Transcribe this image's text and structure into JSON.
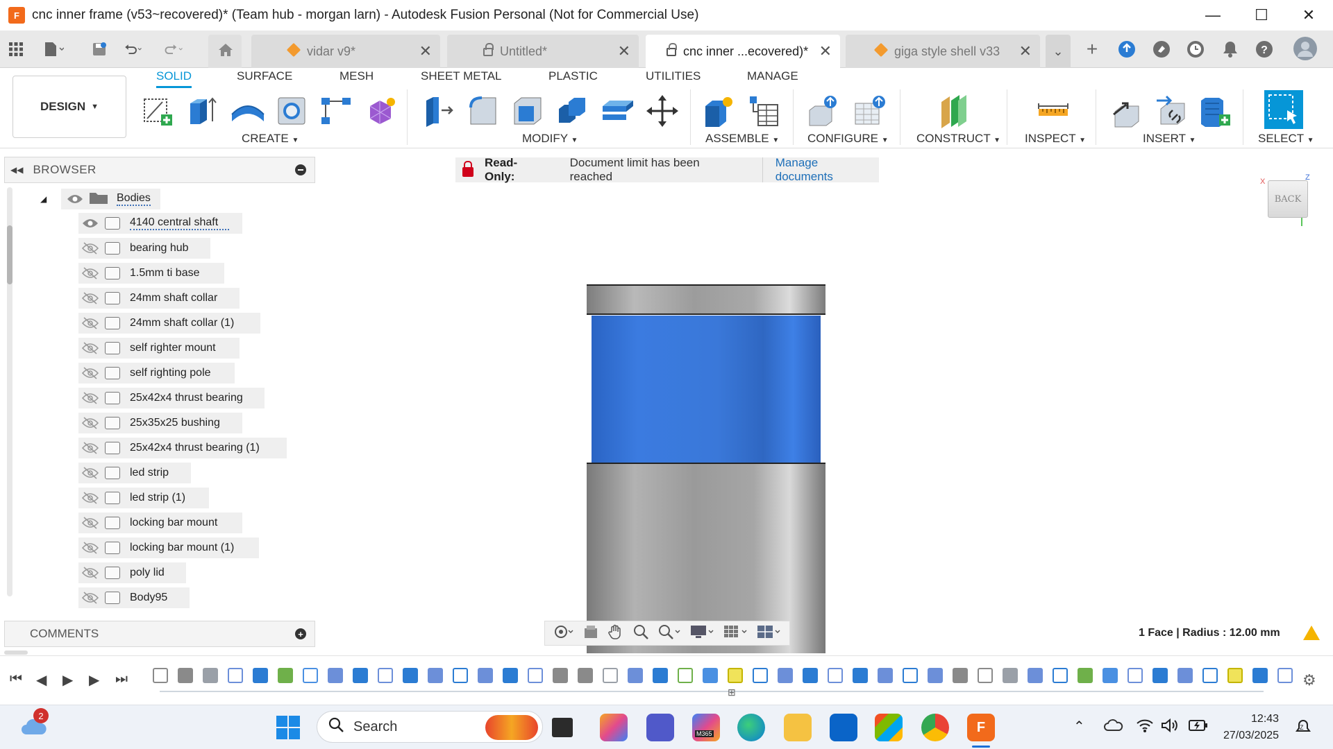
{
  "window": {
    "title": "cnc inner frame (v53~recovered)* (Team hub - morgan larn) - Autodesk Fusion Personal (Not for Commercial Use)",
    "logo_text": "F",
    "controls": {
      "minimize": "—",
      "maximize": "☐",
      "close": "✕"
    }
  },
  "tabs": [
    {
      "label": "vidar v9*",
      "icon": "component-cube-icon",
      "active": false
    },
    {
      "label": "Untitled*",
      "icon": "lock-icon",
      "active": false
    },
    {
      "label": "cnc inner ...ecovered)*",
      "icon": "lock-icon",
      "active": true
    },
    {
      "label": "giga style shell v33",
      "icon": "component-cube-icon",
      "active": false
    }
  ],
  "toolbar": {
    "workspace": "DESIGN",
    "mode_tabs": [
      "SOLID",
      "SURFACE",
      "MESH",
      "SHEET METAL",
      "PLASTIC",
      "UTILITIES",
      "MANAGE"
    ],
    "active_mode": "SOLID",
    "groups": [
      "CREATE",
      "MODIFY",
      "ASSEMBLE",
      "CONFIGURE",
      "CONSTRUCT",
      "INSPECT",
      "INSERT",
      "SELECT"
    ]
  },
  "browser": {
    "title": "BROWSER",
    "folder": "Bodies",
    "items": [
      {
        "label": "4140 central shaft",
        "visible": true
      },
      {
        "label": "bearing hub",
        "visible": false
      },
      {
        "label": "1.5mm ti base",
        "visible": false
      },
      {
        "label": "24mm shaft collar",
        "visible": false
      },
      {
        "label": "24mm shaft collar (1)",
        "visible": false
      },
      {
        "label": "self righter mount",
        "visible": false
      },
      {
        "label": "self righting pole",
        "visible": false
      },
      {
        "label": "25x42x4 thrust bearing",
        "visible": false
      },
      {
        "label": "25x35x25 bushing",
        "visible": false
      },
      {
        "label": "25x42x4 thrust bearing (1)",
        "visible": false
      },
      {
        "label": "led strip",
        "visible": false
      },
      {
        "label": "led strip (1)",
        "visible": false
      },
      {
        "label": "locking bar mount",
        "visible": false
      },
      {
        "label": "locking bar mount (1)",
        "visible": false
      },
      {
        "label": "poly lid",
        "visible": false
      },
      {
        "label": "Body95",
        "visible": false
      }
    ]
  },
  "comments": {
    "title": "COMMENTS"
  },
  "banner": {
    "label": "Read-Only:",
    "message": "Document limit has been reached",
    "link": "Manage documents"
  },
  "viewcube": {
    "face": "BACK",
    "axis_x": "X",
    "axis_z": "Z"
  },
  "status": {
    "selection": "1 Face | Radius : 12.00 mm"
  },
  "taskbar": {
    "search_placeholder": "Search",
    "time": "12:43",
    "date": "27/03/2025",
    "weather_badge": "2",
    "m365_label": "M365"
  },
  "colors": {
    "accent": "#0696d7",
    "selected_face": "#3a78d9",
    "body_metal": "#a0a0a0",
    "readonly_red": "#d0021b",
    "warning": "#f5b400"
  }
}
